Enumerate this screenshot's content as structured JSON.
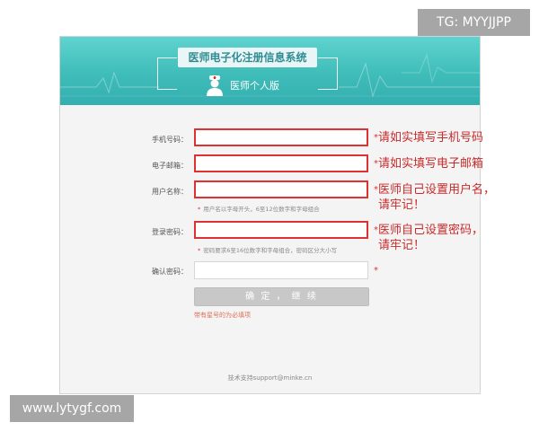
{
  "watermark_top": "TG: MYYJJPP",
  "watermark_bottom": "www.lytygf.com",
  "header": {
    "system_title": "医师电子化注册信息系统",
    "version_label": "医师个人版",
    "doctor_icon": "doctor-icon"
  },
  "form": {
    "phone": {
      "label": "手机号码：",
      "value": "",
      "note": "请如实填写手机号码"
    },
    "email": {
      "label": "电子邮箱：",
      "value": "",
      "note": "请如实填写电子邮箱"
    },
    "username": {
      "label": "用户名称：",
      "value": "",
      "note_line1": "医师自己设置用户名，",
      "note_line2": "请牢记！",
      "hint": "用户名以字母开头，6至12位数字和字母组合"
    },
    "password": {
      "label": "登录密码：",
      "value": "",
      "note_line1": "医师自己设置密码，",
      "note_line2": "请牢记！",
      "hint": "密码要求6至16位数字和字母组合，密码区分大小写"
    },
    "confirm": {
      "label": "确认密码：",
      "value": ""
    },
    "required_star": "*",
    "submit_label": "确 定 ， 继 续",
    "required_note": "带有星号的为必填项"
  },
  "footer": {
    "support": "技术支持support@minke.cn"
  },
  "colors": {
    "banner": "#3fbdb9",
    "highlight": "#e03131",
    "button": "#c8c8c8"
  }
}
